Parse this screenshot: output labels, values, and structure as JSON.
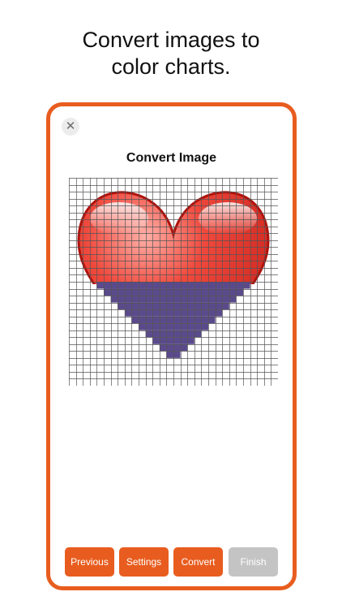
{
  "headline": {
    "line1": "Convert images to",
    "line2": "color charts."
  },
  "dialog": {
    "title": "Convert Image",
    "close_glyph": "✕"
  },
  "buttons": {
    "previous": "Previous",
    "settings": "Settings",
    "convert": "Convert",
    "finish": "Finish"
  },
  "colors": {
    "accent": "#e85d1f",
    "heart_red": "#e32b22",
    "chart_purple": "#5b4a8b",
    "disabled": "#c4c4c4"
  },
  "grid": {
    "columns": 30,
    "rows": 30
  }
}
